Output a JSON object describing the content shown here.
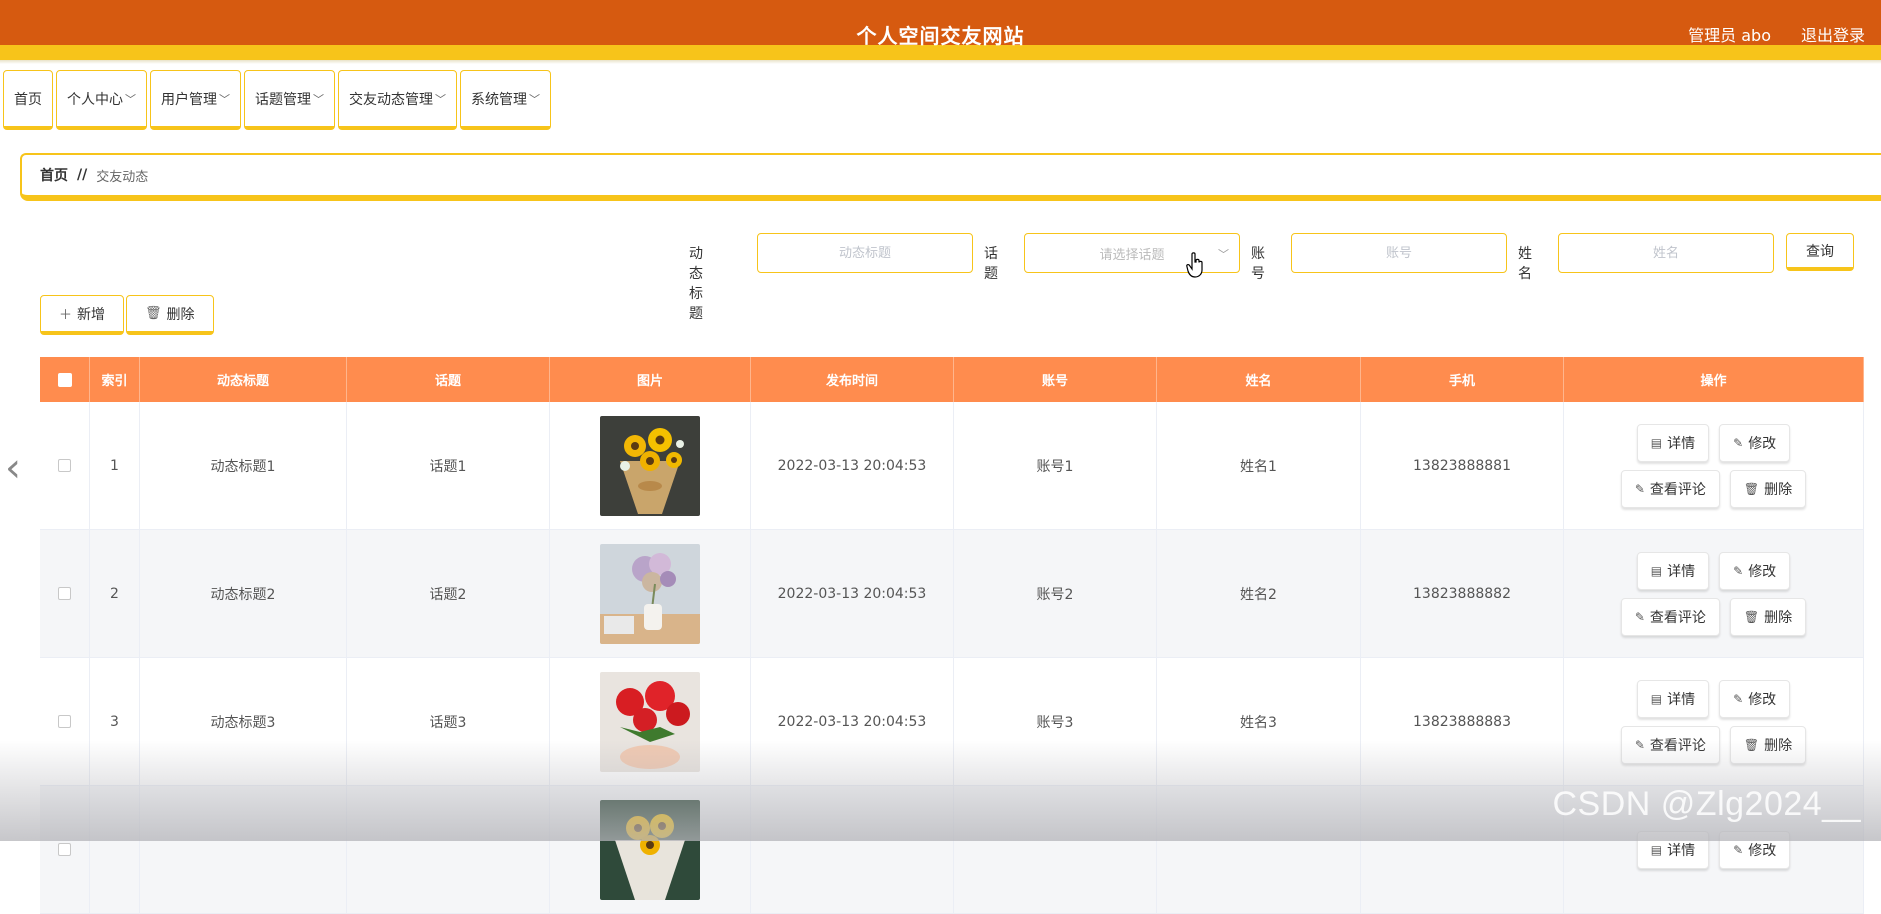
{
  "header": {
    "title": "个人空间交友网站",
    "user": "管理员 abo",
    "logout": "退出登录"
  },
  "menu": [
    {
      "label": "首页",
      "has_dropdown": false
    },
    {
      "label": "个人中心",
      "has_dropdown": true
    },
    {
      "label": "用户管理",
      "has_dropdown": true
    },
    {
      "label": "话题管理",
      "has_dropdown": true
    },
    {
      "label": "交友动态管理",
      "has_dropdown": true
    },
    {
      "label": "系统管理",
      "has_dropdown": true
    }
  ],
  "breadcrumb": {
    "home": "首页",
    "separator": "//",
    "current": "交友动态"
  },
  "search": {
    "title_label": "动态标题",
    "title_placeholder": "动态标题",
    "topic_label": "话题",
    "topic_placeholder": "请选择话题",
    "account_label": "账号",
    "account_placeholder": "账号",
    "name_label": "姓名",
    "name_placeholder": "姓名",
    "query_button": "查询"
  },
  "actions": {
    "add": "新增",
    "delete": "删除"
  },
  "table": {
    "columns": [
      "索引",
      "动态标题",
      "话题",
      "图片",
      "发布时间",
      "账号",
      "姓名",
      "手机",
      "操作"
    ],
    "rows": [
      {
        "index": "1",
        "title": "动态标题1",
        "topic": "话题1",
        "image": "sunflower-bouquet",
        "time": "2022-03-13 20:04:53",
        "account": "账号1",
        "name": "姓名1",
        "phone": "13823888881"
      },
      {
        "index": "2",
        "title": "动态标题2",
        "topic": "话题2",
        "image": "dried-flower-vase",
        "time": "2022-03-13 20:04:53",
        "account": "账号2",
        "name": "姓名2",
        "phone": "13823888882"
      },
      {
        "index": "3",
        "title": "动态标题3",
        "topic": "话题3",
        "image": "red-roses",
        "time": "2022-03-13 20:04:53",
        "account": "账号3",
        "name": "姓名3",
        "phone": "13823888883"
      },
      {
        "index": "",
        "title": "",
        "topic": "",
        "image": "sunflower-bouquet",
        "time": "",
        "account": "",
        "name": "",
        "phone": ""
      }
    ],
    "row_buttons": {
      "detail": "详情",
      "edit": "修改",
      "comments": "查看评论",
      "delete": "删除"
    }
  },
  "watermark": "CSDN @Zlg2024__",
  "colors": {
    "header": "#d65a10",
    "accent": "#f7c41a",
    "table_header": "#ff8c4e"
  }
}
